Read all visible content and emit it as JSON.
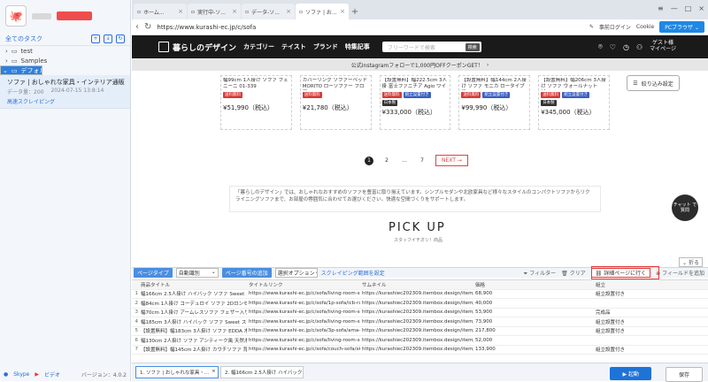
{
  "sidebar": {
    "header": "全てのタスク",
    "folders": [
      "test",
      "Samples",
      "デフォルト"
    ],
    "task": {
      "title": "ソファ | おしゃれな家具・インテリア通販...",
      "meta_label": "データ量：",
      "meta_count": "200",
      "meta_time": "2024-07-15 13:8:14",
      "link": "高速スクレイピング"
    },
    "footer": {
      "link1": "Skype",
      "link2": "ビデオ",
      "version": "バージョン：4.0.2"
    }
  },
  "browser": {
    "tabs": [
      {
        "label": "ホーム..."
      },
      {
        "label": "実行中-ソ..."
      },
      {
        "label": "データ-ソ..."
      },
      {
        "label": "ソファ | お..."
      }
    ],
    "url": "https://www.kurashi-ec.jp/c/sofa",
    "account": "事前ログイン",
    "cookie": "Cookie",
    "pc_browser": "PCブラウザ"
  },
  "site": {
    "brand": "暮らしのデザイン",
    "menu": [
      "カテゴリー",
      "テイスト",
      "ブランド",
      "特集記事"
    ],
    "search_placeholder": "フリーワードで検索",
    "search_btn": "検索",
    "guest": "ゲスト様",
    "mypage": "マイページ",
    "promo": "公式Instagramフォローで1,000円OFFクーポンGET！",
    "narrow_btn": "絞り込み設定",
    "products": [
      {
        "name": "幅99cm 1人掛け ソファ フェニーニ 01-339",
        "tags": [
          {
            "t": "送料無料",
            "c": "red"
          }
        ],
        "price": "¥51,990",
        "tax": "（税込）"
      },
      {
        "name": "カバーリング ソファーベッド MORITO ローソファー フロア...",
        "tags": [
          {
            "t": "送料無料",
            "c": "red"
          }
        ],
        "price": "¥21,780",
        "tax": "（税込）"
      },
      {
        "name": "【設置無料】幅222.5cm 3人掛 富士ファニチア Agio ワイド...",
        "tags": [
          {
            "t": "送料無料",
            "c": "red"
          },
          {
            "t": "組立設置付き",
            "c": "blue"
          },
          {
            "t": "日本製",
            "c": "dark"
          }
        ],
        "price": "¥333,000",
        "tax": "（税込）"
      },
      {
        "name": "【設置無料】幅144cm 2人掛け ソファ モニカ ロータイプ 優...",
        "tags": [
          {
            "t": "送料無料",
            "c": "red"
          },
          {
            "t": "組立設置付き",
            "c": "blue"
          }
        ],
        "price": "¥99,990",
        "tax": "（税込）"
      },
      {
        "name": "【設置無料】幅206cm 3人掛け ソファ ウォールナット 杉...",
        "tags": [
          {
            "t": "送料無料",
            "c": "red"
          },
          {
            "t": "組立設置付き",
            "c": "blue"
          },
          {
            "t": "日本製",
            "c": "dark"
          }
        ],
        "price": "¥345,000",
        "tax": "（税込）"
      }
    ],
    "pager": [
      "1",
      "2",
      "...",
      "7"
    ],
    "next": "NEXT",
    "chat": "チャット\nで質問",
    "desc": "「暮らしのデザイン」では、おしゃれなおすすめのソファを豊富に取り揃えています。シンプルモダンや北欧家具など様々なスタイルのコンパクトソファからリクライニングソファまで、お部屋の雰囲気に合わせてお選びください。快適な空間づくりをサポートします。",
    "pickup": "PICK UP",
    "pickup_sub": "スタッフイチオシ！商品"
  },
  "control": {
    "fold": "折る",
    "page_type_label": "ページタイプ",
    "page_type_value": "自動識別",
    "page_num_label": "ページ番号の追加",
    "page_num_value": "選択オプション",
    "scroll_link": "スクレイピング範囲を設定",
    "filter": "フィルター",
    "delete": "クリア",
    "detail_btn": "詳細ページに行く",
    "field_btn": "フィールドを追加"
  },
  "table": {
    "headers": [
      "商品タイトル",
      "タイトルリンク",
      "サムネイル",
      "価格",
      "組立"
    ],
    "rows": [
      [
        "幅166cm 2.5人掛け ハイバック ソファ Sweet スイー...",
        "https://www.kurashi-ec.jp/c/sofa/living-room-sofa/sw...",
        "https://kurashiec202309.itembox.design/item/src/load...",
        "68,900",
        "組立設置付き"
      ],
      [
        "幅84cm 1人掛け コーデュロイ ソファ 2Dロンセン...",
        "https://www.kurashi-ec.jp/c/sofa/1p-sofa/icb-ras-3569br...",
        "https://kurashiec202309.itembox.design/item/src/load...",
        "40,000",
        ""
      ],
      [
        "幅70cm 1人掛け アームレスソファ フェザー入り 布...",
        "https://www.kurashi-ec.jp/c/sofa/living-room-sofa/sw...",
        "https://kurashiec202309.itembox.design/item/src/load...",
        "53,900",
        "完成品"
      ],
      [
        "幅185cm 3人掛け ハイバック ソファ Sweet スイー...",
        "https://www.kurashi-ec.jp/c/sofa/living-room-sofa/sw...",
        "https://kurashiec202309.itembox.design/item/src/load...",
        "73,900",
        "組立設置付き"
      ],
      [
        "【設置無料】幅183cm 3人掛け ソファ EDDA 木製...",
        "https://www.kurashi-ec.jp/c/sofa/3p-sofa/ama-s36303...",
        "https://kurashiec202309.itembox.design/item/src/load...",
        "217,800",
        "組立設置付き"
      ],
      [
        "幅130cm 2人掛け ソファ アンティーク風 天然木 天...",
        "https://www.kurashi-ec.jp/c/sofa/living-room-sofa/sw...",
        "https://kurashiec202309.itembox.design/item/src/load...",
        "52,000",
        ""
      ],
      [
        "【設置無料】幅145cm 2人掛け カウチソファ 背もた...",
        "https://www.kurashi-ec.jp/c/sofa/couch-sofa/skg-428/",
        "https://kurashiec202309.itembox.design/item/src/load...",
        "133,900",
        "組立設置付き"
      ]
    ]
  },
  "bottom": {
    "tabs": [
      "1. ソファ | おしゃれな家具・...",
      "2. 幅166cm 2.5人掛け ハイバック..."
    ],
    "run": "起動",
    "save": "保存"
  }
}
